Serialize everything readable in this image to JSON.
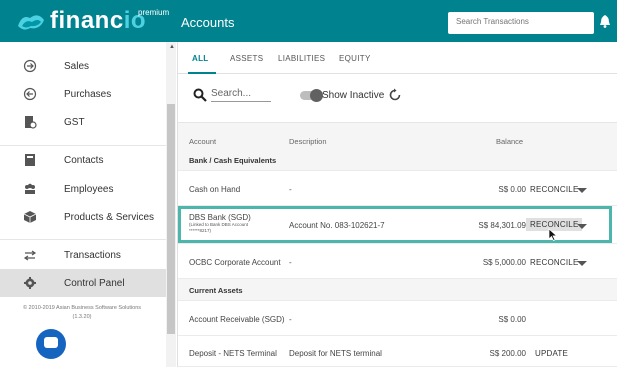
{
  "brand": {
    "name_part1": "financ",
    "name_part2": "io",
    "superscript": "premium"
  },
  "header": {
    "title": "Accounts",
    "search_placeholder": "Search Transactions"
  },
  "sidebar": {
    "items": [
      {
        "label": "Sales",
        "icon": "sales-icon"
      },
      {
        "label": "Purchases",
        "icon": "purchases-icon"
      },
      {
        "label": "GST",
        "icon": "gst-icon"
      },
      {
        "label": "Contacts",
        "icon": "contacts-icon"
      },
      {
        "label": "Employees",
        "icon": "employees-icon"
      },
      {
        "label": "Products & Services",
        "icon": "products-icon"
      },
      {
        "label": "Transactions",
        "icon": "transactions-icon"
      },
      {
        "label": "Control Panel",
        "icon": "gear-icon"
      }
    ],
    "copyright": "© 2010-2019 Asian Business Software Solutions",
    "version": "(1.3.20)"
  },
  "tabs": [
    "ALL",
    "ASSETS",
    "LIABILITIES",
    "EQUITY"
  ],
  "search": {
    "placeholder": "Search..."
  },
  "toggle": {
    "label": "Show Inactive"
  },
  "grid": {
    "headers": {
      "account": "Account",
      "description": "Description",
      "balance": "Balance"
    },
    "groups": [
      {
        "title": "Bank / Cash Equivalents"
      },
      {
        "title": "Current Assets"
      }
    ],
    "rows": [
      {
        "account": "Cash on Hand",
        "description": "-",
        "balance": "S$ 0.00",
        "action": "RECONCILE"
      },
      {
        "account": "DBS Bank (SGD)",
        "account_sub": "(Linked to Bank DBS Account",
        "account_sub2": "******8217)",
        "description": "Account No. 083-102621-7",
        "balance": "S$ 84,301.09",
        "action": "RECONCILE"
      },
      {
        "account": "OCBC Corporate Account",
        "description": "-",
        "balance": "S$ 5,000.00",
        "action": "RECONCILE"
      },
      {
        "account": "Account Receivable (SGD)",
        "description": "-",
        "balance": "S$ 0.00",
        "action": ""
      },
      {
        "account": "Deposit - NETS Terminal",
        "description": "Deposit for NETS terminal",
        "balance": "S$ 200.00",
        "action": "UPDATE"
      }
    ]
  },
  "colors": {
    "primary": "#00838f",
    "accent": "#4dd0e1",
    "highlight": "#4db6ac",
    "chat": "#1565c0"
  }
}
